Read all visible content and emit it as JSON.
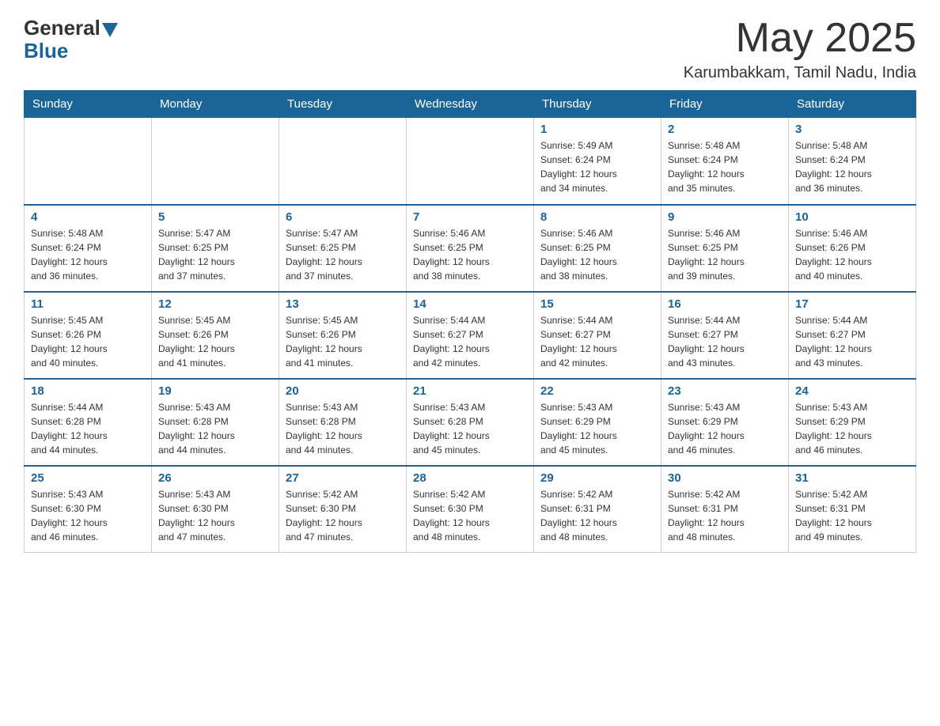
{
  "header": {
    "logo_general": "General",
    "logo_blue": "Blue",
    "month_title": "May 2025",
    "location": "Karumbakkam, Tamil Nadu, India"
  },
  "weekdays": [
    "Sunday",
    "Monday",
    "Tuesday",
    "Wednesday",
    "Thursday",
    "Friday",
    "Saturday"
  ],
  "weeks": [
    [
      {
        "day": "",
        "info": ""
      },
      {
        "day": "",
        "info": ""
      },
      {
        "day": "",
        "info": ""
      },
      {
        "day": "",
        "info": ""
      },
      {
        "day": "1",
        "info": "Sunrise: 5:49 AM\nSunset: 6:24 PM\nDaylight: 12 hours\nand 34 minutes."
      },
      {
        "day": "2",
        "info": "Sunrise: 5:48 AM\nSunset: 6:24 PM\nDaylight: 12 hours\nand 35 minutes."
      },
      {
        "day": "3",
        "info": "Sunrise: 5:48 AM\nSunset: 6:24 PM\nDaylight: 12 hours\nand 36 minutes."
      }
    ],
    [
      {
        "day": "4",
        "info": "Sunrise: 5:48 AM\nSunset: 6:24 PM\nDaylight: 12 hours\nand 36 minutes."
      },
      {
        "day": "5",
        "info": "Sunrise: 5:47 AM\nSunset: 6:25 PM\nDaylight: 12 hours\nand 37 minutes."
      },
      {
        "day": "6",
        "info": "Sunrise: 5:47 AM\nSunset: 6:25 PM\nDaylight: 12 hours\nand 37 minutes."
      },
      {
        "day": "7",
        "info": "Sunrise: 5:46 AM\nSunset: 6:25 PM\nDaylight: 12 hours\nand 38 minutes."
      },
      {
        "day": "8",
        "info": "Sunrise: 5:46 AM\nSunset: 6:25 PM\nDaylight: 12 hours\nand 38 minutes."
      },
      {
        "day": "9",
        "info": "Sunrise: 5:46 AM\nSunset: 6:25 PM\nDaylight: 12 hours\nand 39 minutes."
      },
      {
        "day": "10",
        "info": "Sunrise: 5:46 AM\nSunset: 6:26 PM\nDaylight: 12 hours\nand 40 minutes."
      }
    ],
    [
      {
        "day": "11",
        "info": "Sunrise: 5:45 AM\nSunset: 6:26 PM\nDaylight: 12 hours\nand 40 minutes."
      },
      {
        "day": "12",
        "info": "Sunrise: 5:45 AM\nSunset: 6:26 PM\nDaylight: 12 hours\nand 41 minutes."
      },
      {
        "day": "13",
        "info": "Sunrise: 5:45 AM\nSunset: 6:26 PM\nDaylight: 12 hours\nand 41 minutes."
      },
      {
        "day": "14",
        "info": "Sunrise: 5:44 AM\nSunset: 6:27 PM\nDaylight: 12 hours\nand 42 minutes."
      },
      {
        "day": "15",
        "info": "Sunrise: 5:44 AM\nSunset: 6:27 PM\nDaylight: 12 hours\nand 42 minutes."
      },
      {
        "day": "16",
        "info": "Sunrise: 5:44 AM\nSunset: 6:27 PM\nDaylight: 12 hours\nand 43 minutes."
      },
      {
        "day": "17",
        "info": "Sunrise: 5:44 AM\nSunset: 6:27 PM\nDaylight: 12 hours\nand 43 minutes."
      }
    ],
    [
      {
        "day": "18",
        "info": "Sunrise: 5:44 AM\nSunset: 6:28 PM\nDaylight: 12 hours\nand 44 minutes."
      },
      {
        "day": "19",
        "info": "Sunrise: 5:43 AM\nSunset: 6:28 PM\nDaylight: 12 hours\nand 44 minutes."
      },
      {
        "day": "20",
        "info": "Sunrise: 5:43 AM\nSunset: 6:28 PM\nDaylight: 12 hours\nand 44 minutes."
      },
      {
        "day": "21",
        "info": "Sunrise: 5:43 AM\nSunset: 6:28 PM\nDaylight: 12 hours\nand 45 minutes."
      },
      {
        "day": "22",
        "info": "Sunrise: 5:43 AM\nSunset: 6:29 PM\nDaylight: 12 hours\nand 45 minutes."
      },
      {
        "day": "23",
        "info": "Sunrise: 5:43 AM\nSunset: 6:29 PM\nDaylight: 12 hours\nand 46 minutes."
      },
      {
        "day": "24",
        "info": "Sunrise: 5:43 AM\nSunset: 6:29 PM\nDaylight: 12 hours\nand 46 minutes."
      }
    ],
    [
      {
        "day": "25",
        "info": "Sunrise: 5:43 AM\nSunset: 6:30 PM\nDaylight: 12 hours\nand 46 minutes."
      },
      {
        "day": "26",
        "info": "Sunrise: 5:43 AM\nSunset: 6:30 PM\nDaylight: 12 hours\nand 47 minutes."
      },
      {
        "day": "27",
        "info": "Sunrise: 5:42 AM\nSunset: 6:30 PM\nDaylight: 12 hours\nand 47 minutes."
      },
      {
        "day": "28",
        "info": "Sunrise: 5:42 AM\nSunset: 6:30 PM\nDaylight: 12 hours\nand 48 minutes."
      },
      {
        "day": "29",
        "info": "Sunrise: 5:42 AM\nSunset: 6:31 PM\nDaylight: 12 hours\nand 48 minutes."
      },
      {
        "day": "30",
        "info": "Sunrise: 5:42 AM\nSunset: 6:31 PM\nDaylight: 12 hours\nand 48 minutes."
      },
      {
        "day": "31",
        "info": "Sunrise: 5:42 AM\nSunset: 6:31 PM\nDaylight: 12 hours\nand 49 minutes."
      }
    ]
  ]
}
